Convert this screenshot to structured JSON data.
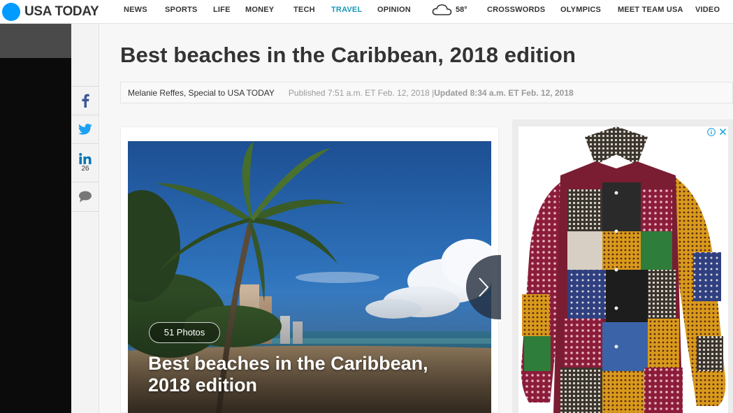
{
  "brand": {
    "name": "USA TODAY",
    "logo_color": "#009bff"
  },
  "nav": {
    "items": [
      {
        "label": "NEWS"
      },
      {
        "label": "SPORTS"
      },
      {
        "label": "LIFE"
      },
      {
        "label": "MONEY"
      },
      {
        "label": "TECH"
      },
      {
        "label": "TRAVEL",
        "active": true
      },
      {
        "label": "OPINION"
      },
      {
        "label": "CROSSWORDS"
      },
      {
        "label": "OLYMPICS"
      },
      {
        "label": "MEET TEAM USA"
      },
      {
        "label": "VIDEO"
      }
    ],
    "weather": {
      "icon": "cloud-icon",
      "temp": "58°"
    },
    "active_color": "#1a98b9"
  },
  "share": {
    "facebook": {
      "icon": "facebook-icon"
    },
    "twitter": {
      "icon": "twitter-icon"
    },
    "linkedin": {
      "icon": "linkedin-icon",
      "count": "26"
    },
    "comments": {
      "icon": "comment-icon"
    }
  },
  "article": {
    "headline": "Best beaches in the Caribbean, 2018 edition",
    "author": "Melanie Reffes, Special to USA TODAY",
    "published": "Published 7:51 a.m. ET Feb. 12, 2018 | ",
    "updated": "Updated 8:34 a.m. ET Feb. 12, 2018"
  },
  "gallery": {
    "photo_count": "51 Photos",
    "title": "Best beaches in the Caribbean, 2018 edition",
    "next_icon": "chevron-right-icon"
  },
  "ad": {
    "info_icon": "info-icon",
    "close_icon": "close-icon"
  }
}
